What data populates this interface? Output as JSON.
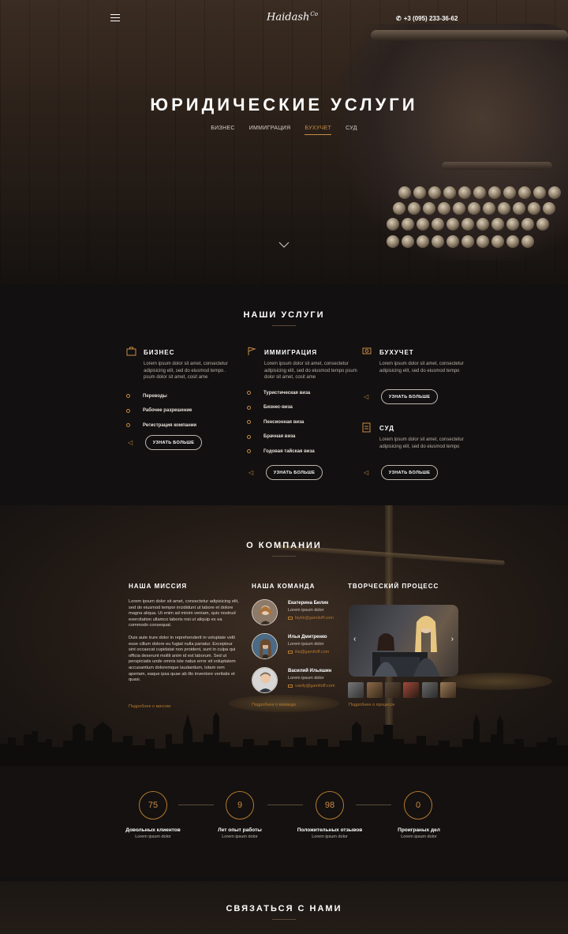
{
  "header": {
    "logo": "Haidash",
    "logo_suffix": "Co",
    "phone": "+3 (095) 233-36-62"
  },
  "hero": {
    "title": "ЮРИДИЧЕСКИЕ УСЛУГИ",
    "nav": [
      "БИЗНЕС",
      "ИММИГРАЦИЯ",
      "БУХУЧЕТ",
      "СУД"
    ],
    "active_nav": "БУХУЧЕТ"
  },
  "services": {
    "title": "НАШИ УСЛУГИ",
    "more_label": "УЗНАТЬ БОЛЬШЕ",
    "business": {
      "title": "БИЗНЕС",
      "desc": "Lorem ipsum dolor sit amet, consectetur adipisicing elit, sed do eiusmod tempo . psum dolor sit amet, cosit ame",
      "items": [
        "Переводы",
        "Рабочее разрешение",
        "Регистрация компании"
      ]
    },
    "immigration": {
      "title": "ИММИГРАЦИЯ",
      "desc": "Lorem ipsum dolor sit amet, consectetur adipisicing elit, sed do eiusmod tempo psum dolor sit amet, cosit ame",
      "items": [
        "Туристическая виза",
        "Бизнес-виза",
        "Пенсионная виза",
        "Брачная виза",
        "Годовая тайская виза"
      ]
    },
    "accounting": {
      "title": "БУХУЧЕТ",
      "desc": "Lorem ipsum dolor sit amet, consectetur adipisicing elit, sed do eiusmod tempo"
    },
    "court": {
      "title": "СУД",
      "desc": "Lorem ipsum dolor sit amet, consectetur adipisicing elit, sed do eiusmod tempo"
    }
  },
  "about": {
    "title": "О КОМПАНИИ",
    "mission": {
      "title": "НАША МИССИЯ",
      "p1": "Lorem ipsum dolor sit amet, consectetur adipisicing elit, sed do eiusmod tempor incididunt ut labore et dolore magna aliqua. Ut enim ad minim veniam, quis nostrud exercitation ullamco laboris nisi ut aliquip ex ea commodo consequat.",
      "p2": "Duis aute irure dolor in reprehenderit in voluptate velit esse cillum dolore eu fugiat nulla pariatur. Excepteur sint occaecat cupidatat non proident, sunt in culpa qui officia deserunt mollit anim id est laborum. Sed ut perspiciatis unde omnis iste natus error sit voluptatem accusantium doloremque laudantium, totam rem aperiam, eaque ipsa quae ab illo inventore veritatis et quasi.",
      "link": "Подробнее о миссии"
    },
    "team": {
      "title": "НАША КОМАНДА",
      "members": [
        {
          "name": "Екатерина Билик",
          "role": "Lorem ipsum dolor",
          "email": "biyiik@gamiloff.com"
        },
        {
          "name": "Илья Дмитренко",
          "role": "Lorem ipsum dolor",
          "email": "ilia@gamiloff.com"
        },
        {
          "name": "Василий Ильяшин",
          "role": "Lorem ipsum dolor",
          "email": "vasily@gamiloff.com"
        }
      ],
      "link": "Подробнее о команде"
    },
    "process": {
      "title": "ТВОРЧЕСКИЙ ПРОЦЕСС",
      "link": "Подробнее о процессе"
    }
  },
  "stats": [
    {
      "value": "75",
      "label": "Довольных клиентов",
      "sub": "Lorem ipsum dolor"
    },
    {
      "value": "9",
      "label": "Лет опыт работы",
      "sub": "Lorem ipsum dolor"
    },
    {
      "value": "98",
      "label": "Положительных отзывов",
      "sub": "Lorem ipsum dolor"
    },
    {
      "value": "0",
      "label": "Проиграных дел",
      "sub": "Lorem ipsum dolor"
    }
  ],
  "contact": {
    "title": "СВЯЗАТЬСЯ С НАМИ"
  },
  "colors": {
    "accent": "#c98b45",
    "background": "#121010"
  }
}
